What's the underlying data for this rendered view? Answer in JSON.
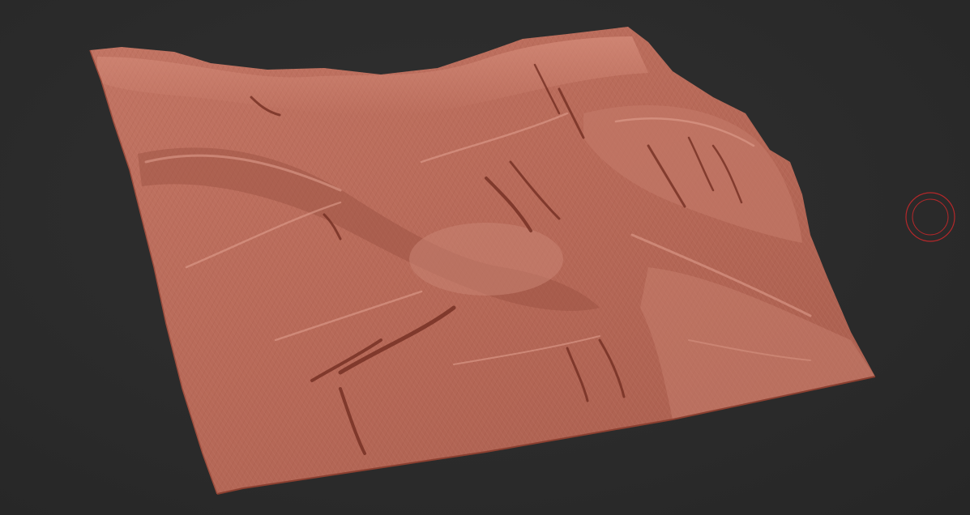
{
  "viewport": {
    "background_color": "#2a2a2a",
    "mesh_color": "#b96a5a",
    "mesh_shadow_color": "#7a3326",
    "cursor_color": "#b4282a"
  },
  "brush_cursor": {
    "icon": "brush-circle-icon"
  }
}
